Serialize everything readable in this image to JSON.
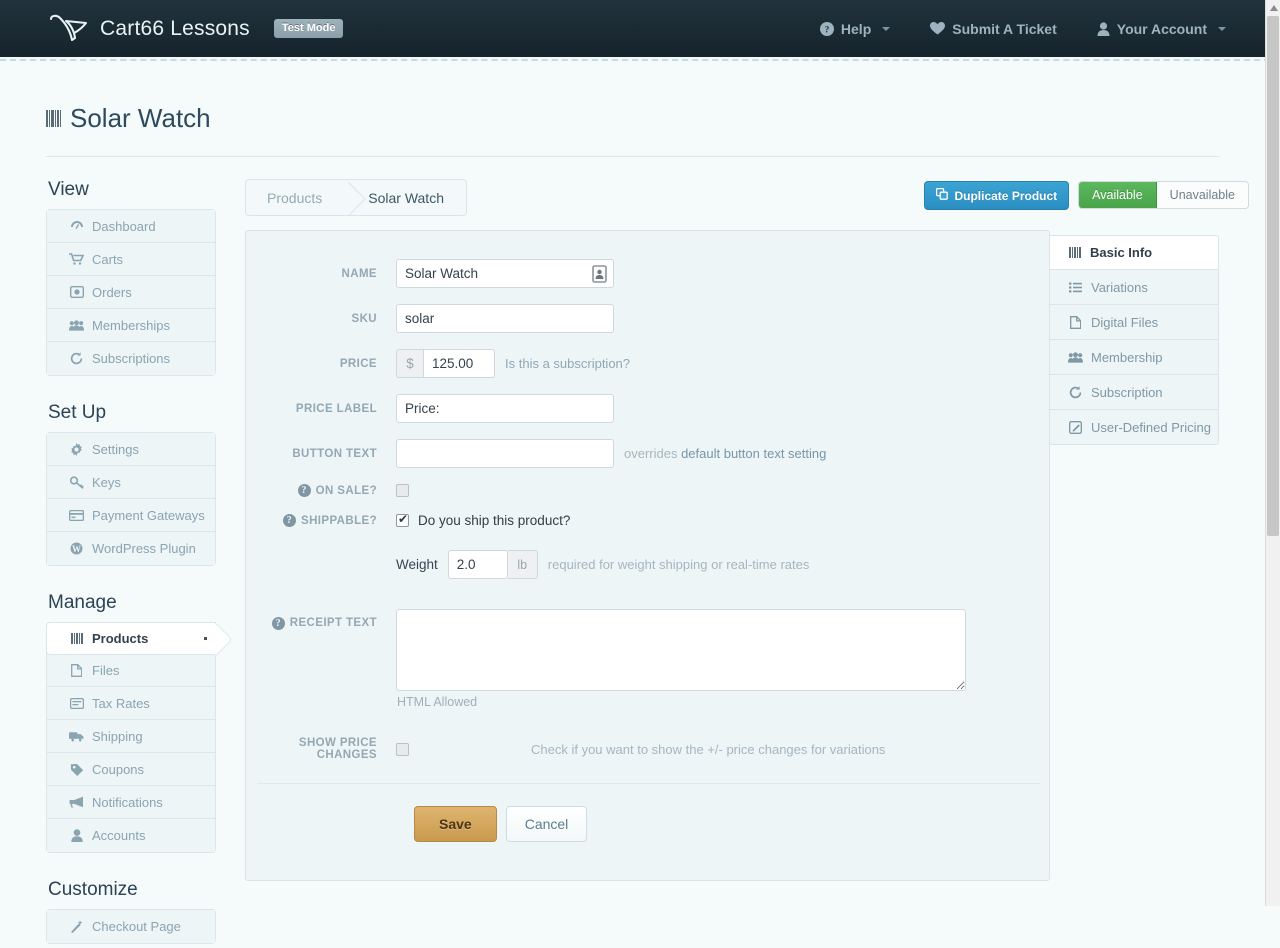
{
  "header": {
    "brand": "Cart66 Lessons",
    "badge": "Test Mode",
    "nav": [
      {
        "label": "Help",
        "icon": "help-circle-icon",
        "caret": true
      },
      {
        "label": "Submit A Ticket",
        "icon": "heart-icon",
        "caret": false
      },
      {
        "label": "Your Account",
        "icon": "user-icon",
        "caret": true
      }
    ]
  },
  "page": {
    "title": "Solar Watch",
    "title_icon": "barcode-icon"
  },
  "sidebar": {
    "groups": [
      {
        "heading": "View",
        "items": [
          {
            "label": "Dashboard",
            "icon": "dashboard-icon",
            "active": false
          },
          {
            "label": "Carts",
            "icon": "cart-icon",
            "active": false
          },
          {
            "label": "Orders",
            "icon": "order-icon",
            "active": false
          },
          {
            "label": "Memberships",
            "icon": "users-icon",
            "active": false
          },
          {
            "label": "Subscriptions",
            "icon": "refresh-icon",
            "active": false
          }
        ]
      },
      {
        "heading": "Set Up",
        "items": [
          {
            "label": "Settings",
            "icon": "gear-icon",
            "active": false
          },
          {
            "label": "Keys",
            "icon": "key-icon",
            "active": false
          },
          {
            "label": "Payment Gateways",
            "icon": "credit-card-icon",
            "active": false
          },
          {
            "label": "WordPress Plugin",
            "icon": "wordpress-icon",
            "active": false
          }
        ]
      },
      {
        "heading": "Manage",
        "items": [
          {
            "label": "Products",
            "icon": "barcode-icon",
            "active": true
          },
          {
            "label": "Files",
            "icon": "file-icon",
            "active": false
          },
          {
            "label": "Tax Rates",
            "icon": "tax-icon",
            "active": false
          },
          {
            "label": "Shipping",
            "icon": "truck-icon",
            "active": false
          },
          {
            "label": "Coupons",
            "icon": "tag-icon",
            "active": false
          },
          {
            "label": "Notifications",
            "icon": "megaphone-icon",
            "active": false
          },
          {
            "label": "Accounts",
            "icon": "user-icon",
            "active": false
          }
        ]
      },
      {
        "heading": "Customize",
        "items": [
          {
            "label": "Checkout Page",
            "icon": "wand-icon",
            "active": false
          }
        ]
      }
    ]
  },
  "breadcrumb": {
    "parent": "Products",
    "current": "Solar Watch"
  },
  "toolbar": {
    "duplicate_label": "Duplicate Product",
    "duplicate_icon": "copy-icon",
    "available_label": "Available",
    "unavailable_label": "Unavailable",
    "available_selected": true,
    "accent_blue": "#2b8ec2",
    "accent_green": "#4aa54a"
  },
  "tabs": [
    {
      "label": "Basic Info",
      "icon": "barcode-icon",
      "active": true
    },
    {
      "label": "Variations",
      "icon": "list-icon",
      "active": false
    },
    {
      "label": "Digital Files",
      "icon": "file-icon",
      "active": false
    },
    {
      "label": "Membership",
      "icon": "users-icon",
      "active": false
    },
    {
      "label": "Subscription",
      "icon": "refresh-icon",
      "active": false
    },
    {
      "label": "User-Defined Pricing",
      "icon": "edit-icon",
      "active": false
    }
  ],
  "form": {
    "name": {
      "label": "Name",
      "value": "Solar Watch",
      "placeholder": "",
      "icon": "contact-card-icon"
    },
    "sku": {
      "label": "SKU",
      "value": "solar",
      "placeholder": ""
    },
    "price": {
      "label": "Price",
      "currency": "$",
      "value": "125.00",
      "link": "Is this a subscription?"
    },
    "price_label": {
      "label": "Price Label",
      "value": "Price:",
      "placeholder": ""
    },
    "button_text": {
      "label": "Button Text",
      "value": "",
      "placeholder": "",
      "hint_prefix": "overrides ",
      "hint_link": "default button text setting"
    },
    "on_sale": {
      "label": "On Sale?",
      "checked": false,
      "help": "?"
    },
    "shippable": {
      "label": "Shippable?",
      "checked": true,
      "help": "?",
      "checkbox_text": "Do you ship this product?"
    },
    "weight": {
      "label": "Weight",
      "value": "2.0",
      "unit": "lb",
      "hint": "required for weight shipping or real-time rates"
    },
    "receipt_text": {
      "label": "Receipt Text",
      "value": "",
      "help": "?",
      "sub_hint": "HTML Allowed"
    },
    "show_price_changes": {
      "label": "Show Price Changes",
      "checked": false,
      "hint": "Check if you want to show the +/- price changes for variations"
    },
    "save_label": "Save",
    "cancel_label": "Cancel"
  }
}
